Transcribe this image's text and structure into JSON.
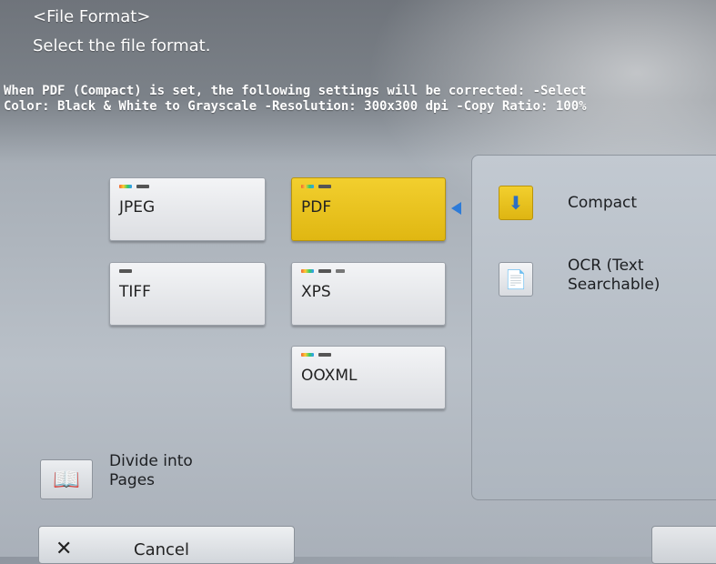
{
  "header": {
    "title": "<File Format>",
    "subtitle": "Select the file format.",
    "notice": "When PDF (Compact) is set, the following settings will be corrected: -Select Color: Black & White to Grayscale -Resolution: 300x300 dpi -Copy Ratio: 100%"
  },
  "formats": [
    {
      "label": "JPEG",
      "selected": false
    },
    {
      "label": "PDF",
      "selected": true
    },
    {
      "label": "TIFF",
      "selected": false
    },
    {
      "label": "XPS",
      "selected": false
    },
    {
      "label": "OOXML",
      "selected": false
    }
  ],
  "pdf_options": [
    {
      "label": "Compact",
      "icon": "compact-icon",
      "selected": true
    },
    {
      "label_line1": "OCR (Text",
      "label_line2": "Searchable)",
      "icon": "ocr-icon",
      "selected": false
    }
  ],
  "divide": {
    "label_line1": "Divide into",
    "label_line2": "Pages",
    "icon": "divide-pages-icon"
  },
  "footer": {
    "cancel_label": "Cancel",
    "cancel_icon": "close-icon"
  },
  "colors": {
    "selected": "#e8c11c",
    "arrow": "#2d7bd8"
  }
}
